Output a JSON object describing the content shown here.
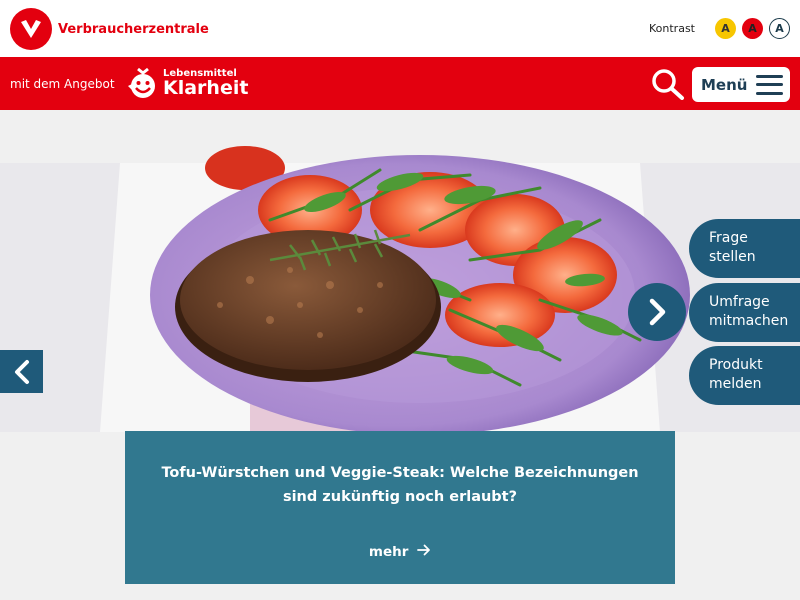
{
  "header": {
    "brand": "Verbraucherzentrale",
    "contrast_label": "Kontrast",
    "contrast_options": [
      "A",
      "A",
      "A"
    ]
  },
  "nav": {
    "offer_text": "mit dem Angebot",
    "offer_logo_small": "Lebensmittel",
    "offer_logo_big": "Klarheit",
    "menu_label": "Menü"
  },
  "side_actions": [
    {
      "line1": "Frage",
      "line2": "stellen"
    },
    {
      "line1": "Umfrage",
      "line2": "mitmachen"
    },
    {
      "line1": "Produkt",
      "line2": "melden"
    }
  ],
  "teaser": {
    "title": "Tofu-Würstchen und Veggie-Steak: Welche Bezeichnungen sind zukünftig noch erlaubt?",
    "more_label": "mehr"
  },
  "colors": {
    "brand_red": "#e3000f",
    "accent_blue": "#1f5a7a",
    "teaser_teal": "#31788f",
    "contrast_yellow": "#f7c600"
  },
  "icons": [
    "v-logo-icon",
    "smiley-logo-icon",
    "search-icon",
    "hamburger-icon",
    "chevron-left-icon",
    "chevron-right-icon",
    "arrow-right-icon"
  ]
}
